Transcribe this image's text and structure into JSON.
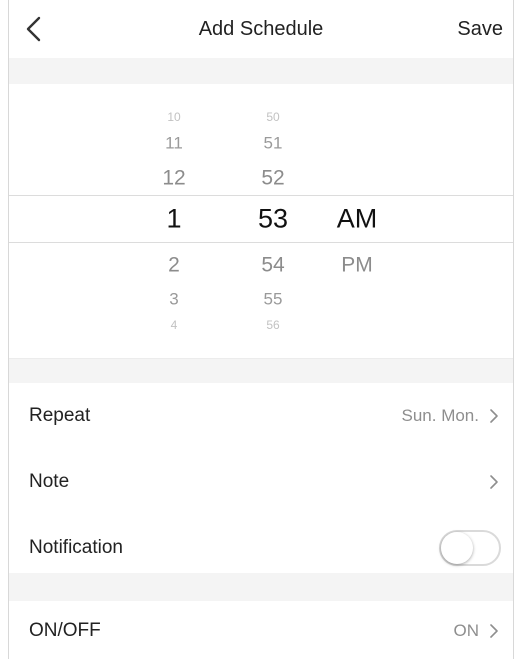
{
  "header": {
    "title": "Add Schedule",
    "save_label": "Save",
    "back_icon": "chevron-left-icon"
  },
  "picker": {
    "hours": [
      "10",
      "11",
      "12",
      "1",
      "2",
      "3",
      "4"
    ],
    "minutes": [
      "50",
      "51",
      "52",
      "53",
      "54",
      "55",
      "56"
    ],
    "periods": [
      "AM",
      "PM"
    ],
    "selected": {
      "hour": "1",
      "minute": "53",
      "period": "AM"
    }
  },
  "settings": {
    "repeat": {
      "label": "Repeat",
      "value": "Sun. Mon."
    },
    "note": {
      "label": "Note",
      "value": ""
    },
    "notification": {
      "label": "Notification",
      "enabled": false
    },
    "onoff": {
      "label": "ON/OFF",
      "value": "ON"
    }
  },
  "icons": {
    "row_chevron": "chevron-right-icon"
  },
  "colors": {
    "text": "#222222",
    "secondary_text": "#8e8e8e",
    "section_gap": "#f4f4f4"
  }
}
